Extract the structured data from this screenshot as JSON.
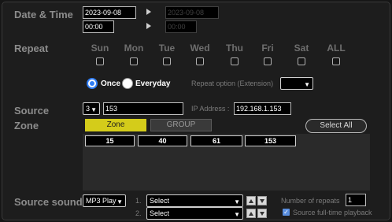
{
  "labels": {
    "date_time": "Date & Time",
    "repeat": "Repeat",
    "source": "Source",
    "zone": "Zone",
    "source_sound": "Source sound"
  },
  "date_time": {
    "start_date": "2023-09-08",
    "start_time": "00:00",
    "end_date": "2023-09-08",
    "end_time": "00:00"
  },
  "days": [
    "Sun",
    "Mon",
    "Tue",
    "Wed",
    "Thu",
    "Fri",
    "Sat",
    "ALL"
  ],
  "repeat_mode": {
    "once": "Once",
    "everyday": "Everyday",
    "selected": "Once",
    "option_label": "Repeat option (Extension)",
    "option_value": ""
  },
  "source": {
    "type_value": "3",
    "id_value": "153",
    "ip_label": "IP Address :",
    "ip_value": "192.168.1.153"
  },
  "zone": {
    "tab_zone": "Zone",
    "tab_group": "GROUP",
    "select_all": "Select All",
    "cells": [
      "15",
      "40",
      "61",
      "153"
    ]
  },
  "source_sound": {
    "player": "MP3 Play",
    "rows": [
      {
        "index": "1.",
        "value": "Select"
      },
      {
        "index": "2.",
        "value": "Select"
      }
    ],
    "repeats_label": "Number of repeats",
    "repeats_value": "1",
    "fulltime_label": "Source full-time playback"
  },
  "colors": {
    "zone_tab_active": "#d4cc1a",
    "radio_accent": "#2f7df5",
    "background": "#1d1d1d"
  }
}
